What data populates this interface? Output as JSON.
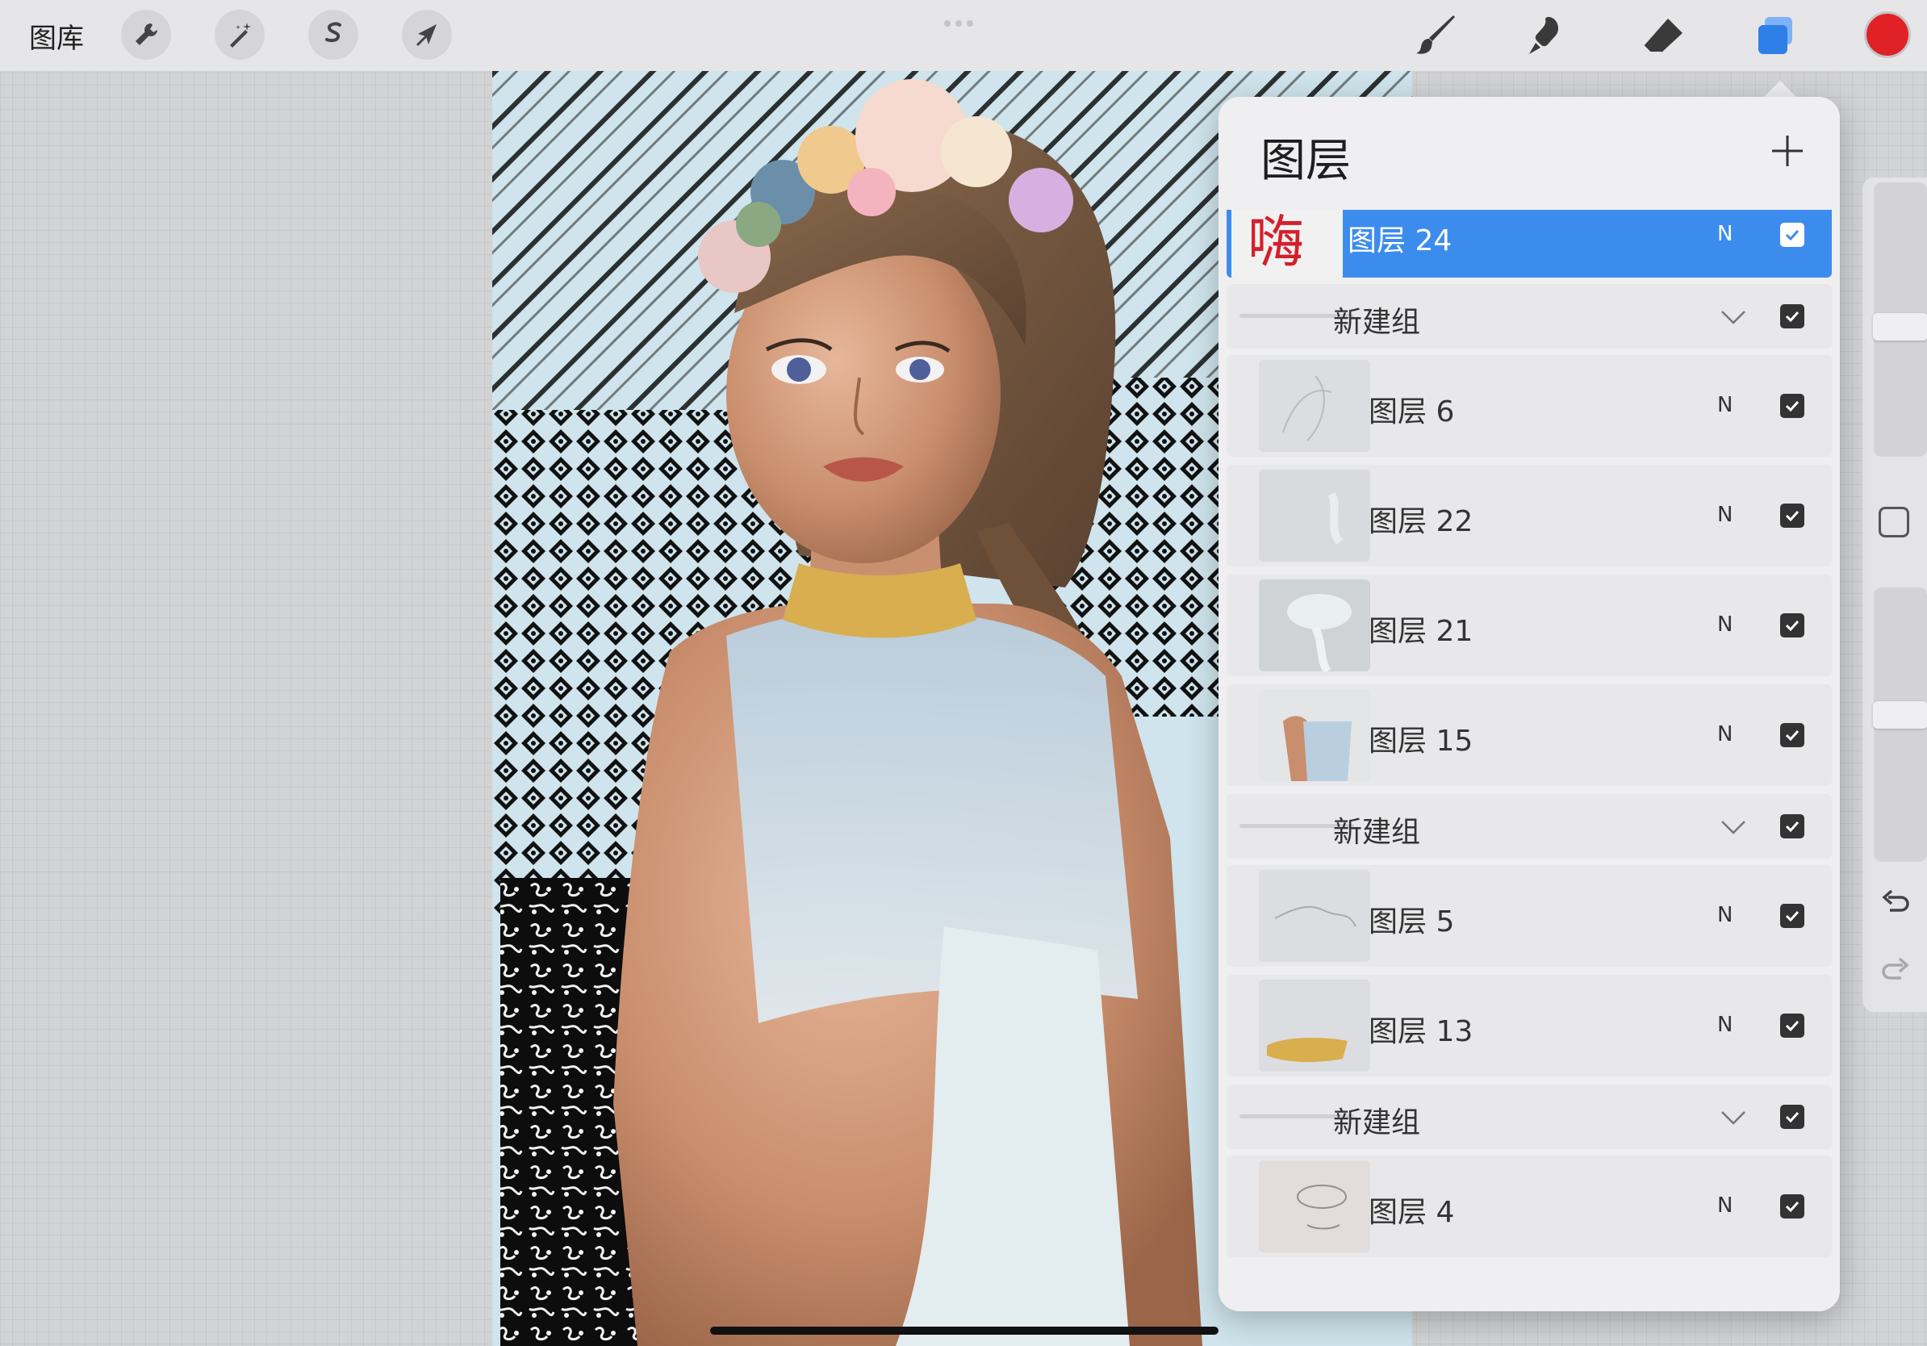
{
  "toolbar": {
    "gallery_label": "图库",
    "left_tools": [
      "wrench-icon",
      "magic-wand-icon",
      "selection-icon",
      "move-arrow-icon"
    ],
    "right_tools": [
      "brush-icon",
      "smudge-icon",
      "eraser-icon",
      "layers-icon"
    ],
    "current_color": "#e02227",
    "accent_color": "#3c8cee"
  },
  "layers_panel": {
    "title": "图层",
    "add_icon": "plus-icon",
    "layers": [
      {
        "type": "layer",
        "name": "图层 24",
        "mode": "N",
        "visible": true,
        "selected": true
      },
      {
        "type": "group",
        "name": "新建组",
        "visible": true
      },
      {
        "type": "layer",
        "name": "图层 6",
        "mode": "N",
        "visible": true
      },
      {
        "type": "layer",
        "name": "图层 22",
        "mode": "N",
        "visible": true
      },
      {
        "type": "layer",
        "name": "图层 21",
        "mode": "N",
        "visible": true
      },
      {
        "type": "layer",
        "name": "图层 15",
        "mode": "N",
        "visible": true
      },
      {
        "type": "group",
        "name": "新建组",
        "visible": true
      },
      {
        "type": "layer",
        "name": "图层 5",
        "mode": "N",
        "visible": true
      },
      {
        "type": "layer",
        "name": "图层 13",
        "mode": "N",
        "visible": true
      },
      {
        "type": "group",
        "name": "新建组",
        "visible": true
      },
      {
        "type": "layer",
        "name": "图层 4",
        "mode": "N",
        "visible": true
      }
    ]
  },
  "sidebar": {
    "brush_size_level": 0.47,
    "opacity_level": 0.54,
    "undo_icon": "undo-icon",
    "redo_icon": "redo-icon"
  }
}
